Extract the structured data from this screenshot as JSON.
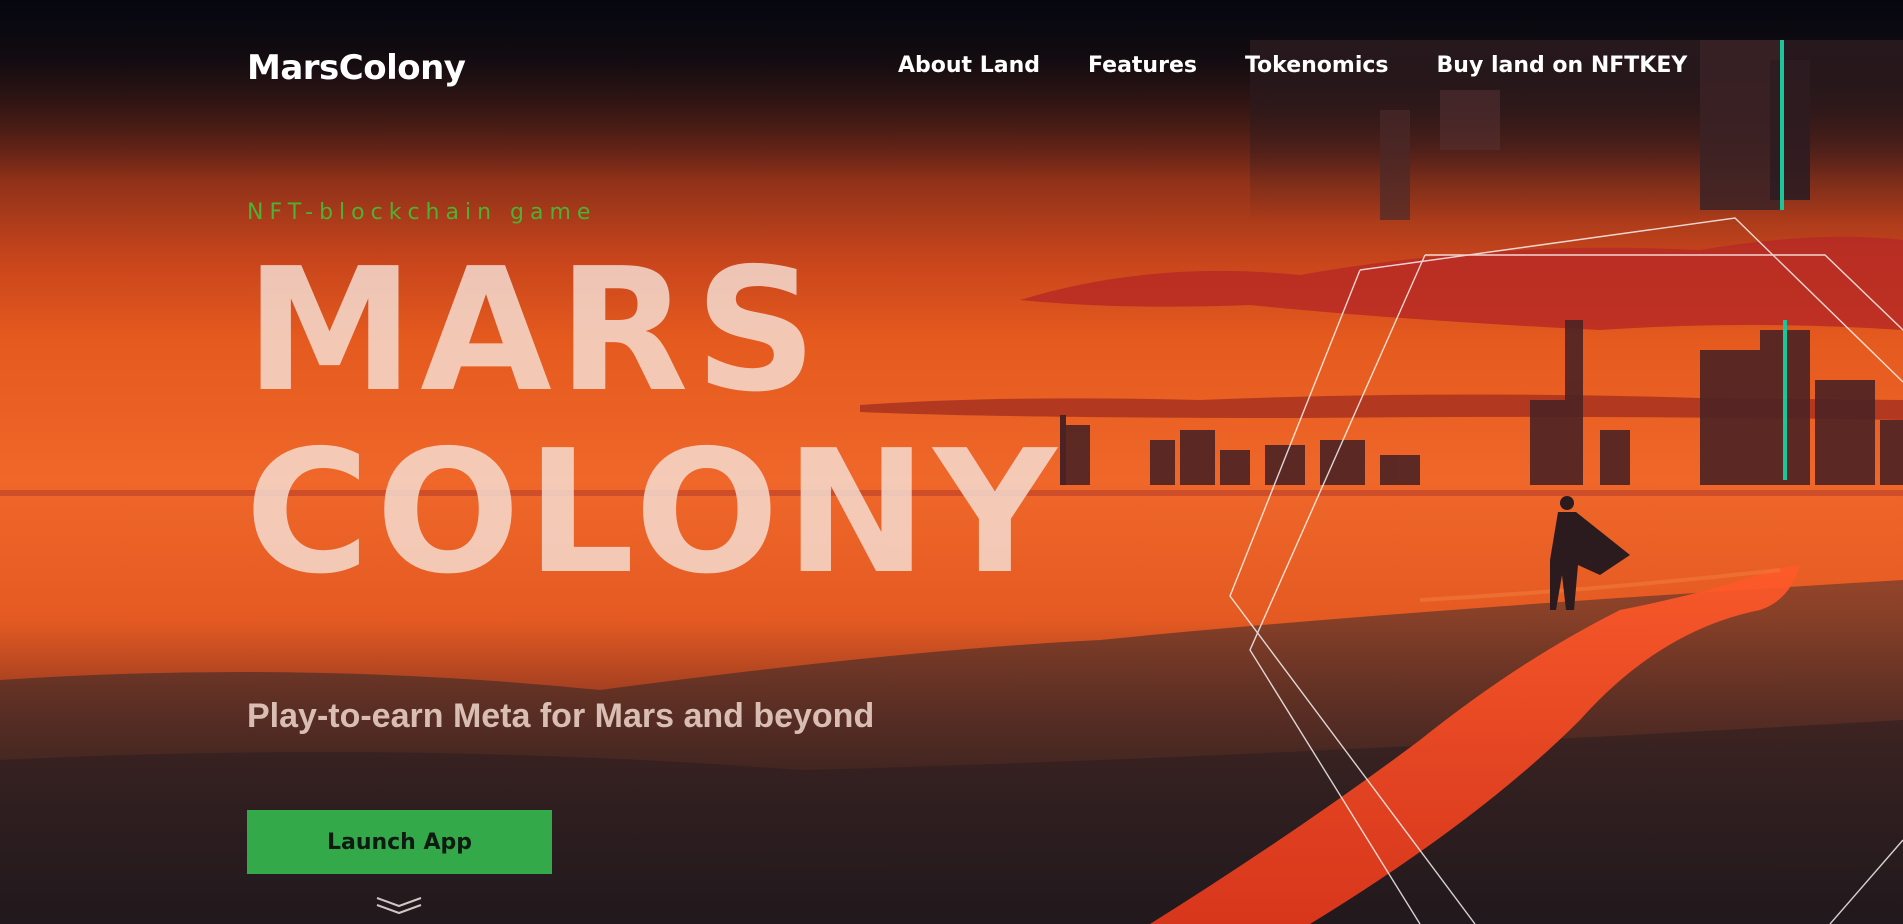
{
  "nav": {
    "logo": "MarsColony",
    "links": [
      "About Land",
      "Features",
      "Tokenomics",
      "Buy land on NFTKEY"
    ]
  },
  "hero": {
    "eyebrow": "NFT-blockchain game",
    "title_line1": "MARS",
    "title_line2": "COLONY",
    "tagline": "Play-to-earn Meta for Mars and beyond",
    "cta_label": "Launch App",
    "scroll_icon": "double-chevron-down-icon"
  },
  "colors": {
    "accent": "#34a94a",
    "eyebrow": "#4db232",
    "nav_bg": "#05070f"
  }
}
